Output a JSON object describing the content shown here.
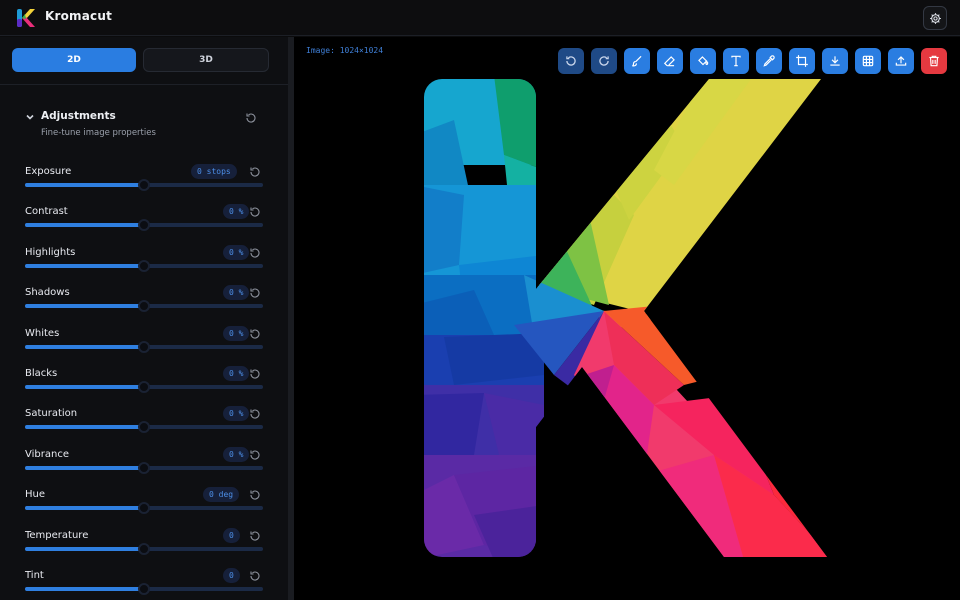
{
  "app": {
    "title": "Kromacut"
  },
  "modes": {
    "active": "2D",
    "inactive": "3D"
  },
  "adjustments": {
    "title": "Adjustments",
    "subtitle": "Fine-tune image properties",
    "rows": [
      {
        "label": "Exposure",
        "value": "0 stops",
        "level": 0.5
      },
      {
        "label": "Contrast",
        "value": "0 %",
        "level": 0.5
      },
      {
        "label": "Highlights",
        "value": "0 %",
        "level": 0.5
      },
      {
        "label": "Shadows",
        "value": "0 %",
        "level": 0.5
      },
      {
        "label": "Whites",
        "value": "0 %",
        "level": 0.5
      },
      {
        "label": "Blacks",
        "value": "0 %",
        "level": 0.5
      },
      {
        "label": "Saturation",
        "value": "0 %",
        "level": 0.5
      },
      {
        "label": "Vibrance",
        "value": "0 %",
        "level": 0.5
      },
      {
        "label": "Hue",
        "value": "0 deg",
        "level": 0.5
      },
      {
        "label": "Temperature",
        "value": "0",
        "level": 0.5
      },
      {
        "label": "Tint",
        "value": "0",
        "level": 0.5
      }
    ]
  },
  "canvas": {
    "image_info": "Image: 1024×1024"
  },
  "toolbar": {
    "buttons": [
      "undo-icon",
      "redo-icon",
      "brush-icon",
      "eraser-icon",
      "fill-bucket-icon",
      "text-icon",
      "eyedropper-icon",
      "crop-icon",
      "download-icon",
      "grid-icon",
      "upload-icon",
      "trash-icon"
    ]
  },
  "colors": {
    "accent": "#2a7de1",
    "danger": "#e53940",
    "background": "#000000",
    "sidebar": "#0e0f12"
  }
}
